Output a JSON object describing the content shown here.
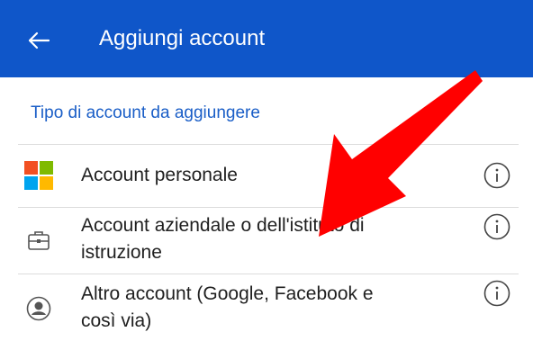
{
  "app_bar": {
    "title": "Aggiungi account",
    "back_icon": "arrow-left-icon",
    "color": "#0f56c9"
  },
  "section": {
    "header": "Tipo di account da aggiungere",
    "color": "#1a5ec7"
  },
  "account_types": [
    {
      "label": "Account personale",
      "icon": "microsoft-logo-icon"
    },
    {
      "label_line1": "Account aziendale o dell'istituto di",
      "label_line2": "istruzione",
      "icon": "briefcase-icon"
    },
    {
      "label_line1": "Altro account (Google, Facebook e",
      "label_line2": "così via)",
      "icon": "person-icon"
    }
  ],
  "info_icon": "info-icon",
  "annotation": {
    "icon": "red-arrow-annotation",
    "color": "#ff0000"
  }
}
